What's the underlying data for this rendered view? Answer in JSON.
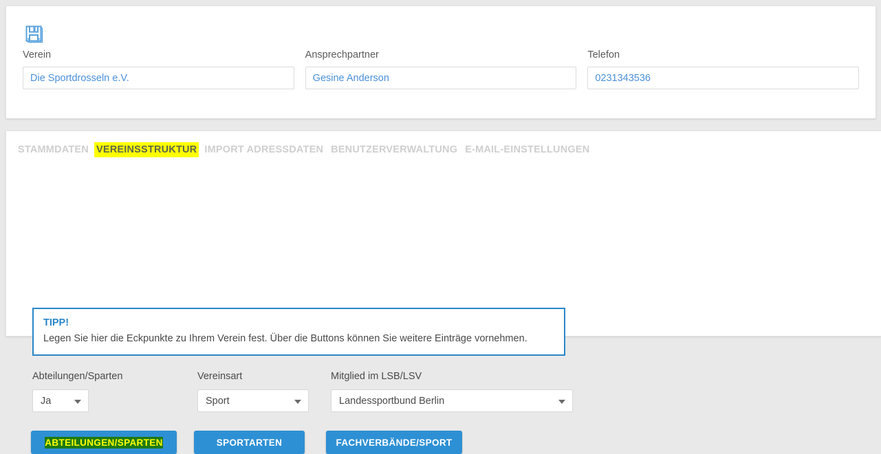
{
  "toolbar": {
    "save_icon": "floppy-disk-save-icon"
  },
  "master_data": {
    "fields": [
      {
        "label": "Verein",
        "value": "Die Sportdrosseln e.V."
      },
      {
        "label": "Ansprechpartner",
        "value": "Gesine Anderson"
      },
      {
        "label": "Telefon",
        "value": "0231343536"
      }
    ]
  },
  "tabs": [
    {
      "label": "STAMMDATEN",
      "active": false
    },
    {
      "label": "VEREINSSTRUKTUR",
      "active": true
    },
    {
      "label": "IMPORT ADRESSDATEN",
      "active": false
    },
    {
      "label": "BENUTZERVERWALTUNG",
      "active": false
    },
    {
      "label": "E-MAIL-EINSTELLUNGEN",
      "active": false
    }
  ],
  "tip": {
    "title": "TIPP!",
    "text": "Legen Sie hier die Eckpunkte zu Ihrem Verein fest. Über die Buttons können Sie weitere Einträge vornehmen."
  },
  "selects": [
    {
      "label": "Abteilungen/Sparten",
      "value": "Ja"
    },
    {
      "label": "Vereinsart",
      "value": "Sport"
    },
    {
      "label": "Mitglied im LSB/LSV",
      "value": "Landessportbund Berlin"
    }
  ],
  "buttons": [
    {
      "label": "ABTEILUNGEN/SPARTEN",
      "highlighted": true
    },
    {
      "label": "SPORTARTEN",
      "highlighted": false
    },
    {
      "label": "FACHVERBÄNDE/SPORT",
      "highlighted": false
    }
  ],
  "colors": {
    "accent_blue": "#2e90d4",
    "tip_border": "#2a86c8",
    "input_text_blue": "#4a90d9",
    "tab_inactive": "#cfcfcf",
    "highlight_yellow": "#ffff00",
    "highlight_green": "#1e7a14",
    "page_background": "#e9e9e9"
  }
}
